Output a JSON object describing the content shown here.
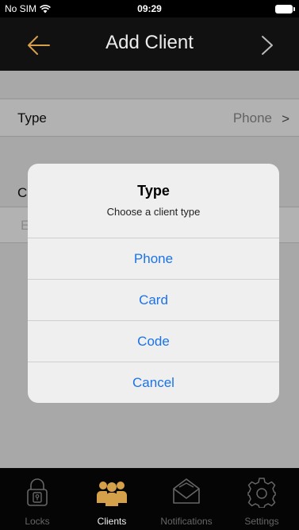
{
  "status": {
    "carrier": "No SIM",
    "time": "09:29"
  },
  "nav": {
    "title": "Add Client"
  },
  "form": {
    "type_label": "Type",
    "type_value": "Phone",
    "type_chevron": ">",
    "c_label": "C",
    "e_placeholder": "E"
  },
  "dialog": {
    "title": "Type",
    "message": "Choose a client type",
    "options": [
      "Phone",
      "Card",
      "Code"
    ],
    "cancel": "Cancel"
  },
  "tabs": [
    {
      "label": "Locks",
      "icon": "lock-icon",
      "active": false
    },
    {
      "label": "Clients",
      "icon": "people-icon",
      "active": true
    },
    {
      "label": "Notifications",
      "icon": "envelope-icon",
      "active": false
    },
    {
      "label": "Settings",
      "icon": "gear-icon",
      "active": false
    }
  ],
  "colors": {
    "accent": "#d4a04a",
    "link": "#1a73e8",
    "bar": "#111111"
  }
}
